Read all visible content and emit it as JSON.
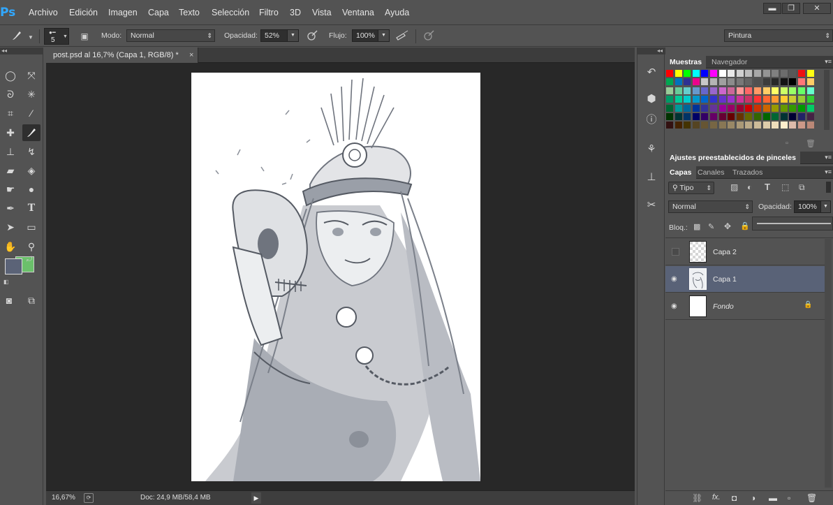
{
  "app": {
    "logo": "Ps"
  },
  "menu": [
    "Archivo",
    "Edición",
    "Imagen",
    "Capa",
    "Texto",
    "Selección",
    "Filtro",
    "3D",
    "Vista",
    "Ventana",
    "Ayuda"
  ],
  "window_buttons": {
    "minimize": "▬",
    "restore": "❐",
    "close": "✕"
  },
  "options": {
    "brush_size": "5",
    "mode_label": "Modo:",
    "mode_value": "Normal",
    "opacity_label": "Opacidad:",
    "opacity_value": "52%",
    "flow_label": "Flujo:",
    "flow_value": "100%",
    "workspace": "Pintura"
  },
  "document": {
    "tab_title": "post.psd al 16,7% (Capa 1, RGB/8) *",
    "tab_close": "×"
  },
  "status": {
    "zoom": "16,67%",
    "doc": "Doc: 24,9 MB/58,4 MB"
  },
  "panels": {
    "top_tabs": [
      "Muestras",
      "Navegador"
    ],
    "brush_presets": "Ajustes preestablecidos de pinceles",
    "layer_tabs": [
      "Capas",
      "Canales",
      "Trazados"
    ],
    "filter_kind": "Tipo",
    "blend_mode": "Normal",
    "opacity_label": "Opacidad:",
    "opacity_value": "100%",
    "lock_label": "Bloq.:"
  },
  "layers": [
    {
      "name": "Capa 2",
      "visible": false,
      "selected": false
    },
    {
      "name": "Capa 1",
      "visible": true,
      "selected": true
    },
    {
      "name": "Fondo",
      "visible": true,
      "selected": false,
      "locked": true
    }
  ],
  "colors": {
    "foreground": "#5b6377",
    "background": "#6bc06b",
    "selection": "#596277"
  },
  "swatches": [
    [
      "#ff0000",
      "#ffff00",
      "#00ff00",
      "#00ffff",
      "#0000ff",
      "#ff00ff",
      "#ffffff",
      "#e8e8e8",
      "#d0d0d0",
      "#bcbcbc",
      "#a8a8a8",
      "#949494",
      "#808080",
      "#6c6c6c",
      "#585858",
      "#ee1111",
      "#ffff11"
    ],
    [
      "#00a651",
      "#0072bc",
      "#2e3192",
      "#ec008c",
      "#c8c8c8",
      "#b4b4b4",
      "#a0a0a0",
      "#8c8c8c",
      "#787878",
      "#646464",
      "#505050",
      "#3c3c3c",
      "#282828",
      "#141414",
      "#000000",
      "#ff7777",
      "#ffcc66"
    ],
    [
      "#99cc99",
      "#66cc99",
      "#66cccc",
      "#6699cc",
      "#6666cc",
      "#9966cc",
      "#cc66cc",
      "#cc6699",
      "#ff9999",
      "#ff6666",
      "#ff9966",
      "#ffcc66",
      "#ffff66",
      "#ccff66",
      "#99ff66",
      "#66ff66",
      "#66ffcc"
    ],
    [
      "#009966",
      "#00cc99",
      "#00cccc",
      "#0099cc",
      "#0066cc",
      "#3333cc",
      "#6633cc",
      "#9933cc",
      "#cc3399",
      "#cc3366",
      "#ff3333",
      "#ff6633",
      "#ff9933",
      "#ffcc33",
      "#cccc33",
      "#99cc33",
      "#33cc33"
    ],
    [
      "#006633",
      "#009999",
      "#006699",
      "#003399",
      "#333399",
      "#663399",
      "#990099",
      "#990066",
      "#990033",
      "#cc0000",
      "#cc3300",
      "#cc6600",
      "#999900",
      "#669900",
      "#339900",
      "#009900",
      "#00cc66"
    ],
    [
      "#003300",
      "#003333",
      "#003366",
      "#000066",
      "#330066",
      "#660066",
      "#660033",
      "#660000",
      "#663300",
      "#666600",
      "#336600",
      "#006600",
      "#006633",
      "#003333",
      "#000033",
      "#222266",
      "#442244"
    ],
    [
      "#331111",
      "#442200",
      "#443300",
      "#554422",
      "#665533",
      "#776644",
      "#887755",
      "#998866",
      "#aa9977",
      "#bbaa88",
      "#ccbb99",
      "#ddccaa",
      "#eeddbb",
      "#ffeecc",
      "#ddbbaa",
      "#cc9988",
      "#bb8877"
    ]
  ],
  "icons": {
    "brush": "brush-icon",
    "marquee": "ellipse-marquee-icon",
    "move": "move-icon"
  }
}
